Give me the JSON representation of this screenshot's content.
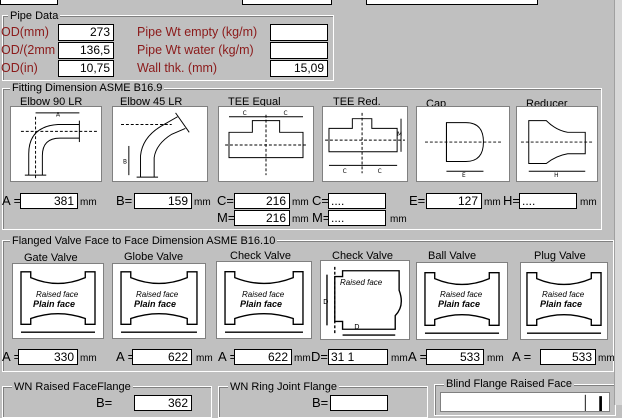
{
  "pipe": {
    "title": "Pipe Data",
    "od_mm_label": "OD(mm)",
    "od_mm": "273",
    "od2_label": "OD/(2mm",
    "od2": "136,5",
    "od_in_label": "OD(in)",
    "od_in": "10,75",
    "wt_empty_label": "Pipe Wt empty (kg/m)",
    "wt_empty": "",
    "wt_water_label": "Pipe Wt water (kg/m)",
    "wt_water": "",
    "wall_label": "Wall thk. (mm)",
    "wall": "15,09"
  },
  "fitting": {
    "title": "Fitting Dimension ASME B16.9",
    "items": [
      {
        "title": "Elbow 90 LR",
        "icon": "elbow-90-diagram"
      },
      {
        "title": "Elbow 45 LR",
        "icon": "elbow-45-diagram"
      },
      {
        "title": "TEE Equal",
        "icon": "tee-equal-diagram"
      },
      {
        "title": "TEE Red.",
        "icon": "tee-reducing-diagram"
      },
      {
        "title": "Cap",
        "icon": "cap-diagram"
      },
      {
        "title": "Reducer",
        "icon": "reducer-diagram"
      }
    ],
    "a_label": "A =",
    "a_value": "381",
    "b_label": "B=",
    "b_value": "159",
    "c_label": "C=",
    "c_value": "216",
    "m_label": "M=",
    "m_value": "216",
    "c2_label": "C=",
    "c2_value": "....",
    "m2_label": "M=",
    "m2_value": "....",
    "e_label": "E=",
    "e_value": "127",
    "h_label": "H=",
    "h_value": "....",
    "unit": "mm"
  },
  "valve": {
    "title": "Flanged Valve Face to Face Dimension ASME B16.10",
    "items": [
      {
        "title": "Gate Valve"
      },
      {
        "title": "Globe Valve"
      },
      {
        "title": "Check Valve"
      },
      {
        "title": "Check Valve"
      },
      {
        "title": "Ball Valve"
      },
      {
        "title": "Plug  Valve"
      }
    ],
    "face_line1": "Raised face",
    "face_line2": "Plain face",
    "face_single": "Raised face",
    "gate_label": "A =",
    "gate_value": "330",
    "globe_label": "A =",
    "globe_value": "622",
    "check_label": "A =",
    "check_value": "622",
    "check2_label": "D=",
    "check2_value": "31 1",
    "ball_label": "A =",
    "ball_value": "533",
    "plug_label": "A =",
    "plug_value": "533",
    "unit": "mm"
  },
  "bottom": {
    "wn_raised": "WN Raised FaceFlange",
    "wn_raised_b_label": "B=",
    "wn_raised_b": "362",
    "wn_ring": "WN Ring Joint Flange",
    "wn_ring_b_label": "B=",
    "blind": "Blind Flange Raised Face"
  }
}
